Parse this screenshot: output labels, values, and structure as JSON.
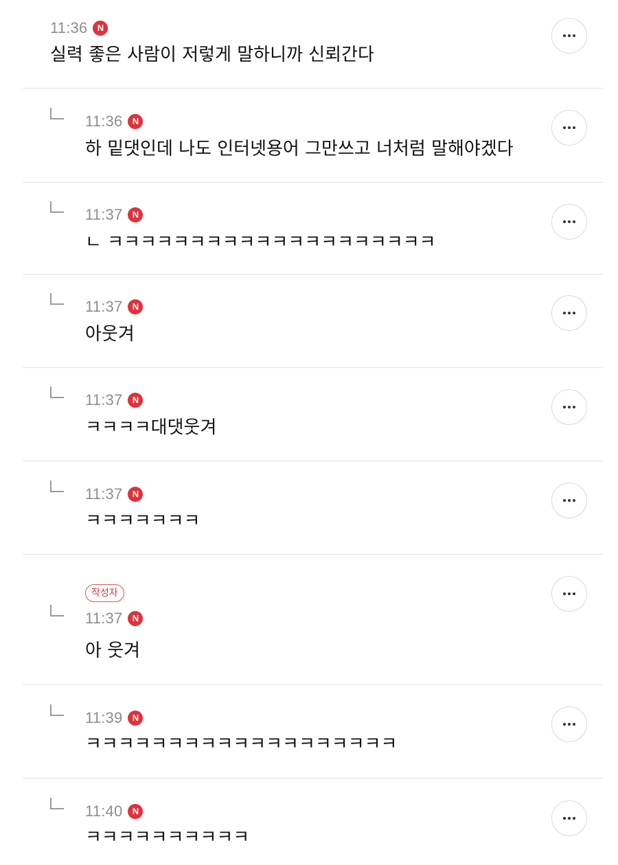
{
  "comments": [
    {
      "time": "11:36",
      "badge": "N",
      "text": "실력 좋은 사람이 저렇게 말하니까 신뢰간다",
      "is_reply": false
    },
    {
      "time": "11:36",
      "badge": "N",
      "text": "하 밑댓인데 나도 인터넷용어 그만쓰고 너처럼 말해야겠다",
      "is_reply": true
    },
    {
      "time": "11:37",
      "badge": "N",
      "text": "ㄴ ㅋㅋㅋㅋㅋㅋㅋㅋㅋㅋㅋㅋㅋㅋㅋㅋㅋㅋㅋㅋ",
      "is_reply": true
    },
    {
      "time": "11:37",
      "badge": "N",
      "text": "아웃겨",
      "is_reply": true
    },
    {
      "time": "11:37",
      "badge": "N",
      "text": "ㅋㅋㅋㅋ대댓웃겨",
      "is_reply": true
    },
    {
      "time": "11:37",
      "badge": "N",
      "text": "ㅋㅋㅋㅋㅋㅋㅋ",
      "is_reply": true
    },
    {
      "time": "11:37",
      "badge": "N",
      "author_label": "작성자",
      "text": "아 웃겨",
      "is_reply": true
    },
    {
      "time": "11:39",
      "badge": "N",
      "text": "ㅋㅋㅋㅋㅋㅋㅋㅋㅋㅋㅋㅋㅋㅋㅋㅋㅋㅋㅋ",
      "is_reply": true
    },
    {
      "time": "11:40",
      "badge": "N",
      "text": "ㅋㅋㅋㅋㅋㅋㅋㅋㅋㅋ",
      "is_reply": true
    }
  ],
  "icons": {
    "more": "more-horizontal-icon",
    "reply": "reply-arrow-icon"
  },
  "colors": {
    "new_badge": "#e0313c",
    "author_badge": "#d93a3a",
    "time": "#8d8d8d"
  }
}
